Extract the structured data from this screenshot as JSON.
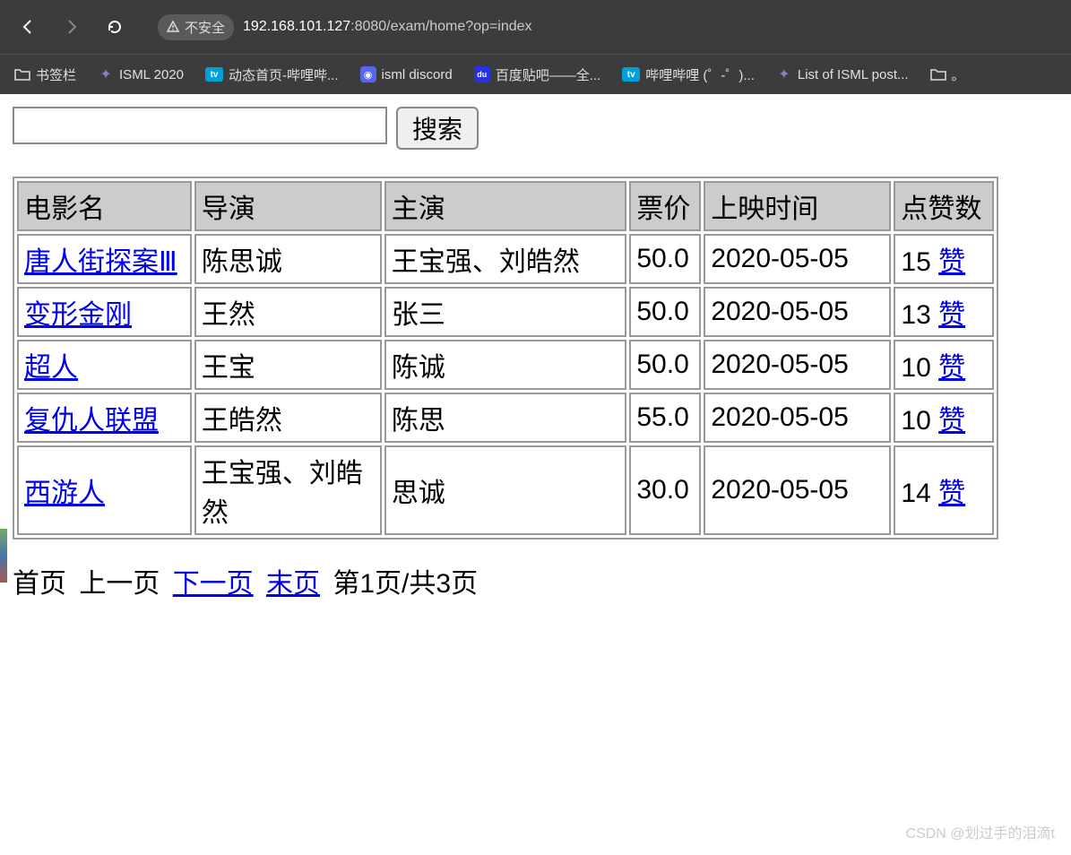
{
  "browser": {
    "insecure_label": "不安全",
    "url_host": "192.168.101.127",
    "url_path": ":8080/exam/home?op=index"
  },
  "bookmarks": [
    {
      "label": "书签栏",
      "icon": "folder"
    },
    {
      "label": "ISML 2020",
      "icon": "star"
    },
    {
      "label": "动态首页-哔哩哔...",
      "icon": "bili"
    },
    {
      "label": "isml discord",
      "icon": "discord"
    },
    {
      "label": "百度贴吧——全...",
      "icon": "baidu"
    },
    {
      "label": "哔哩哔哩 (゜-゜)...",
      "icon": "bili"
    },
    {
      "label": "List of ISML post...",
      "icon": "star"
    },
    {
      "label": "。",
      "icon": "folder"
    }
  ],
  "search": {
    "value": "",
    "button": "搜索"
  },
  "table": {
    "headers": [
      "电影名",
      "导演",
      "主演",
      "票价",
      "上映时间",
      "点赞数"
    ],
    "rows": [
      {
        "name": "唐人街探案Ⅲ",
        "director": "陈思诚",
        "actor": "王宝强、刘皓然",
        "price": "50.0",
        "date": "2020-05-05",
        "likes": "15",
        "action": "赞"
      },
      {
        "name": "变形金刚",
        "director": "王然",
        "actor": "张三",
        "price": "50.0",
        "date": "2020-05-05",
        "likes": "13",
        "action": "赞"
      },
      {
        "name": "超人",
        "director": "王宝",
        "actor": "陈诚",
        "price": "50.0",
        "date": "2020-05-05",
        "likes": "10",
        "action": "赞"
      },
      {
        "name": "复仇人联盟",
        "director": "王皓然",
        "actor": "陈思",
        "price": "55.0",
        "date": "2020-05-05",
        "likes": "10",
        "action": "赞"
      },
      {
        "name": "西游人",
        "director": "王宝强、刘皓然",
        "actor": "思诚",
        "price": "30.0",
        "date": "2020-05-05",
        "likes": "14",
        "action": "赞"
      }
    ]
  },
  "pager": {
    "first": "首页",
    "prev": "上一页",
    "next": "下一页",
    "last": "末页",
    "status": "第1页/共3页"
  },
  "watermark": "CSDN @划过手的泪滴t"
}
